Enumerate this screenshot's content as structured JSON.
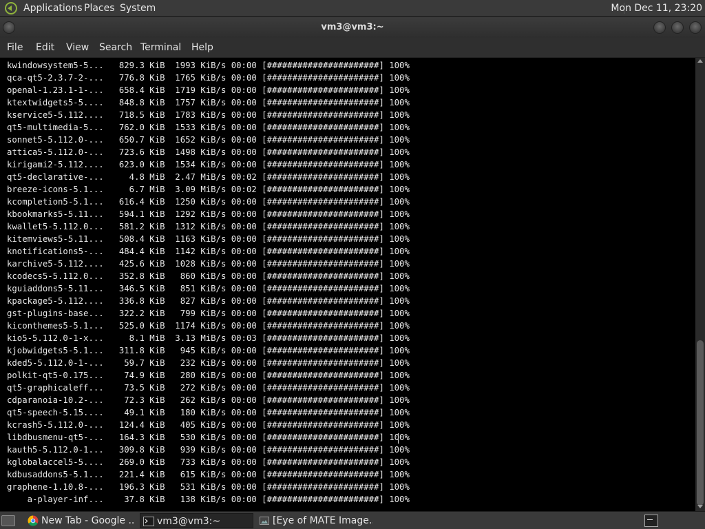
{
  "top_panel": {
    "menus": [
      "Applications",
      "Places",
      "System"
    ],
    "clock": "Mon Dec 11, 23:20"
  },
  "window": {
    "title": "vm3@vm3:~"
  },
  "menubar": [
    "File",
    "Edit",
    "View",
    "Search",
    "Terminal",
    "Help"
  ],
  "terminal": {
    "lines": [
      "kwindowsystem5-5...   829.3 KiB  1993 KiB/s 00:00 [######################] 100%",
      "qca-qt5-2.3.7-2-...   776.8 KiB  1765 KiB/s 00:00 [######################] 100%",
      "openal-1.23.1-1-...   658.4 KiB  1719 KiB/s 00:00 [######################] 100%",
      "ktextwidgets5-5....   848.8 KiB  1757 KiB/s 00:00 [######################] 100%",
      "kservice5-5.112....   718.5 KiB  1783 KiB/s 00:00 [######################] 100%",
      "qt5-multimedia-5...   762.0 KiB  1533 KiB/s 00:00 [######################] 100%",
      "sonnet5-5.112.0-...   650.7 KiB  1652 KiB/s 00:00 [######################] 100%",
      "attica5-5.112.0-...   723.6 KiB  1498 KiB/s 00:00 [######################] 100%",
      "kirigami2-5.112....   623.0 KiB  1534 KiB/s 00:00 [######################] 100%",
      "qt5-declarative-...     4.8 MiB  2.47 MiB/s 00:02 [######################] 100%",
      "breeze-icons-5.1...     6.7 MiB  3.09 MiB/s 00:02 [######################] 100%",
      "kcompletion5-5.1...   616.4 KiB  1250 KiB/s 00:00 [######################] 100%",
      "kbookmarks5-5.11...   594.1 KiB  1292 KiB/s 00:00 [######################] 100%",
      "kwallet5-5.112.0...   581.2 KiB  1312 KiB/s 00:00 [######################] 100%",
      "kitemviews5-5.11...   508.4 KiB  1163 KiB/s 00:00 [######################] 100%",
      "knotifications5-...   484.4 KiB  1142 KiB/s 00:00 [######################] 100%",
      "karchive5-5.112....   425.6 KiB  1028 KiB/s 00:00 [######################] 100%",
      "kcodecs5-5.112.0...   352.8 KiB   860 KiB/s 00:00 [######################] 100%",
      "kguiaddons5-5.11...   346.5 KiB   851 KiB/s 00:00 [######################] 100%",
      "kpackage5-5.112....   336.8 KiB   827 KiB/s 00:00 [######################] 100%",
      "gst-plugins-base...   322.2 KiB   799 KiB/s 00:00 [######################] 100%",
      "kiconthemes5-5.1...   525.0 KiB  1174 KiB/s 00:00 [######################] 100%",
      "kio5-5.112.0-1-x...     8.1 MiB  3.13 MiB/s 00:03 [######################] 100%",
      "kjobwidgets5-5.1...   311.8 KiB   945 KiB/s 00:00 [######################] 100%",
      "kded5-5.112.0-1-...    59.7 KiB   232 KiB/s 00:00 [######################] 100%",
      "polkit-qt5-0.175...    74.9 KiB   280 KiB/s 00:00 [######################] 100%",
      "qt5-graphicaleff...    73.5 KiB   272 KiB/s 00:00 [######################] 100%",
      "cdparanoia-10.2-...    72.3 KiB   262 KiB/s 00:00 [######################] 100%",
      "qt5-speech-5.15....    49.1 KiB   180 KiB/s 00:00 [######################] 100%",
      "kcrash5-5.112.0-...   124.4 KiB   405 KiB/s 00:00 [######################] 100%",
      "libdbusmenu-qt5-...   164.3 KiB   530 KiB/s 00:00 [######################] 100%",
      "kauth5-5.112.0-1...   309.8 KiB   939 KiB/s 00:00 [######################] 100%",
      "kglobalaccel5-5....   269.0 KiB   733 KiB/s 00:00 [######################] 100%",
      "kdbusaddons5-5.1...   221.4 KiB   615 KiB/s 00:00 [######################] 100%",
      "graphene-1.10.8-...   196.3 KiB   531 KiB/s 00:00 [######################] 100%",
      "    a-player-inf...    37.8 KiB   138 KiB/s 00:00 [######################] 100%"
    ]
  },
  "taskbar": {
    "tasks": [
      "New Tab - Google ...",
      "vm3@vm3:~",
      "[Eye of MATE Image..."
    ]
  }
}
